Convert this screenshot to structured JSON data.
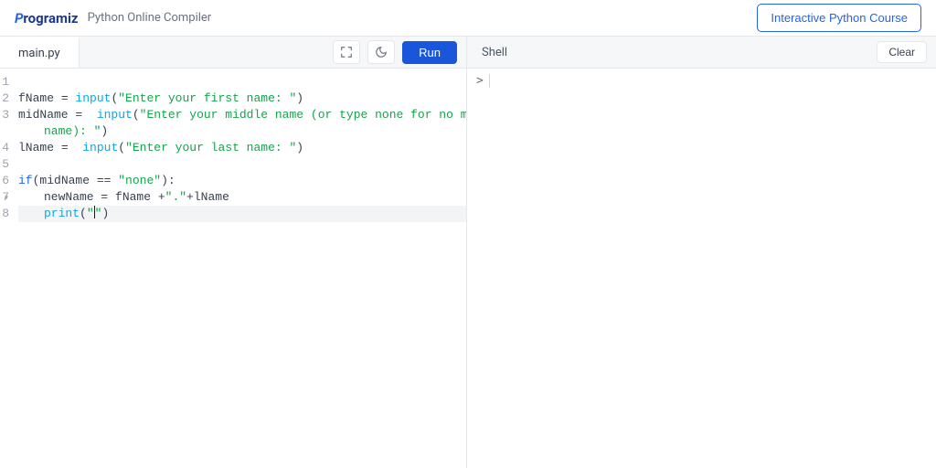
{
  "header": {
    "logo_text": "Programiz",
    "subtitle": "Python Online Compiler",
    "interactive_btn": "Interactive Python Course"
  },
  "editor": {
    "tab_label": "main.py",
    "run_label": "Run",
    "gutter": [
      "1",
      "2",
      "3",
      "",
      "4",
      "5",
      "6",
      "7",
      "8"
    ],
    "fold_at": "6",
    "code_lines": [
      {
        "n": 1,
        "tokens": []
      },
      {
        "n": 2,
        "tokens": [
          {
            "c": "tok-id",
            "t": "fName"
          },
          {
            "c": "tok-op",
            "t": " = "
          },
          {
            "c": "tok-fn",
            "t": "input"
          },
          {
            "c": "tok-op",
            "t": "("
          },
          {
            "c": "tok-str",
            "t": "\"Enter your first name: \""
          },
          {
            "c": "tok-op",
            "t": ")"
          }
        ]
      },
      {
        "n": 3,
        "tokens": [
          {
            "c": "tok-id",
            "t": "midName"
          },
          {
            "c": "tok-op",
            "t": " =  "
          },
          {
            "c": "tok-fn",
            "t": "input"
          },
          {
            "c": "tok-op",
            "t": "("
          },
          {
            "c": "tok-str",
            "t": "\"Enter your middle name (or type none for no middle "
          }
        ]
      },
      {
        "n": 3,
        "cls": "indent1",
        "tokens": [
          {
            "c": "tok-str",
            "t": "name): \""
          },
          {
            "c": "tok-op",
            "t": ")"
          }
        ]
      },
      {
        "n": 4,
        "tokens": [
          {
            "c": "tok-id",
            "t": "lName"
          },
          {
            "c": "tok-op",
            "t": " =  "
          },
          {
            "c": "tok-fn",
            "t": "input"
          },
          {
            "c": "tok-op",
            "t": "("
          },
          {
            "c": "tok-str",
            "t": "\"Enter your last name: \""
          },
          {
            "c": "tok-op",
            "t": ")"
          }
        ]
      },
      {
        "n": 5,
        "tokens": []
      },
      {
        "n": 6,
        "tokens": [
          {
            "c": "tok-kw",
            "t": "if"
          },
          {
            "c": "tok-op",
            "t": "("
          },
          {
            "c": "tok-id",
            "t": "midName"
          },
          {
            "c": "tok-op",
            "t": " == "
          },
          {
            "c": "tok-str",
            "t": "\"none\""
          },
          {
            "c": "tok-op",
            "t": "):"
          }
        ]
      },
      {
        "n": 7,
        "cls": "indent2",
        "tokens": [
          {
            "c": "tok-id",
            "t": "newName"
          },
          {
            "c": "tok-op",
            "t": " = "
          },
          {
            "c": "tok-id",
            "t": "fName"
          },
          {
            "c": "tok-op",
            "t": " +"
          },
          {
            "c": "tok-str",
            "t": "\".\""
          },
          {
            "c": "tok-op",
            "t": "+"
          },
          {
            "c": "tok-id",
            "t": "lName"
          }
        ]
      },
      {
        "n": 8,
        "cls": "indent2 lineactive",
        "active": true,
        "tokens": [
          {
            "c": "tok-fn",
            "t": "print"
          },
          {
            "c": "tok-op",
            "t": "("
          },
          {
            "c": "tok-str",
            "t": "\""
          },
          {
            "caret": true
          },
          {
            "c": "tok-str",
            "t": "\""
          },
          {
            "c": "tok-op",
            "t": ")"
          }
        ]
      }
    ]
  },
  "shell": {
    "title": "Shell",
    "clear_label": "Clear",
    "prompt": ">"
  }
}
